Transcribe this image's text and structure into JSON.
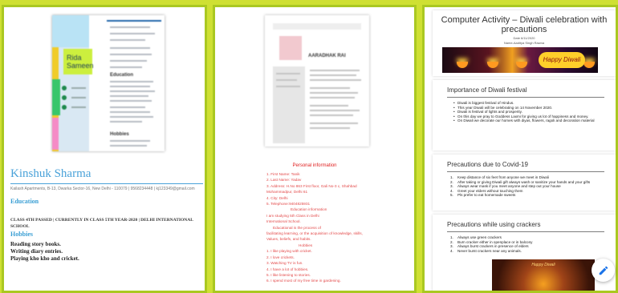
{
  "cards": {
    "resume1": {
      "mini_name": "Rida Sameen",
      "mini_section_education": "Education",
      "mini_section_hobbies": "Hobbies",
      "name": "Kinshuk Sharma",
      "address": "Kailash Apartments, B-13, Dwarka Sector-16, New Delhi - 110079 | 9568234448 | kj123349@gmail.com",
      "education_heading": "Education",
      "education_text": "CLASS 4TH PASSED | CURRENTLY IN CLASS 5TH YEAR-2020 | DELHI INTERNATIONAL SCHOOL",
      "hobbies_heading": "Hobbies",
      "hobbies": [
        "Reading story books.",
        "Writing diary entries.",
        "Playing kho kho and cricket."
      ]
    },
    "resume2": {
      "mini_name": "AARADHAK RAI",
      "title": "Personal information",
      "lines": [
        "1. First Name: Tanik",
        "2. Last Name: Yadav",
        "3. Address: H.No 863 First floor, Gali No-3 c, Shahbad",
        "   Mohammadpur, Delhi 61",
        "4. City: Delhi",
        "5. Telephone:9404825931",
        "Education information",
        "I am studying 5th Class in Delhi",
        "International School.",
        "Educational is the process of",
        "facilitating learning, or the acquisition of knowledge, skills,",
        "Values, beliefs, and habits.",
        "Hobbies",
        "1. I like playing with cricket.",
        "2. I love crickets.",
        "3. Watching TV is fun.",
        "4. I have a lot of hobbies.",
        "5. I like listening to stories.",
        "6. I spend most of my free time in gardening."
      ]
    },
    "slides": {
      "title": "Computer Activity – Diwali celebration with precautions",
      "date": "Date 6/11/2020",
      "author": "Name-Aaditya Singh Rawna",
      "banner_text": "Happy Diwali",
      "importance_heading": "Importance of Diwali festival",
      "importance_points": [
        "Diwali is biggest festival of Hindus.",
        "This year Diwali will be celebrating on 14 November 2020.",
        "Diwali is festival of lights and prosperity.",
        "On this day we pray to Goddess Laxmi for giving us lot of happiness and money.",
        "On Diwali we decorate our homes with diyas, flowers, ragoli and decoration material"
      ],
      "covid_heading": "Precautions due to Covid-19",
      "covid_points": [
        "Keep distance of six feet from anyone we meet in Diwali",
        "After taking or giving Diwali gift always wash or sanitize your hands and your gifts",
        "Always wear mask if you meet anyone and step out your house",
        "Greet your elders without touching them",
        "Pls prefer to eat homemade sweets"
      ],
      "crackers_heading": "Precautions while using crackers",
      "crackers_points": [
        "Always use green crackers",
        "Burn cracker either in openplace or in balcony",
        "Always burst crackers in presence of elders",
        "Never burst crackers near any animals."
      ],
      "crackers_image_text": "Happy Diwali"
    }
  },
  "fab": {
    "icon": "pencil-icon"
  },
  "colors": {
    "background": "#cfe033",
    "card_border": "#aac821",
    "resume_blue": "#4aa2d9",
    "personal_red": "#e34a4a"
  }
}
